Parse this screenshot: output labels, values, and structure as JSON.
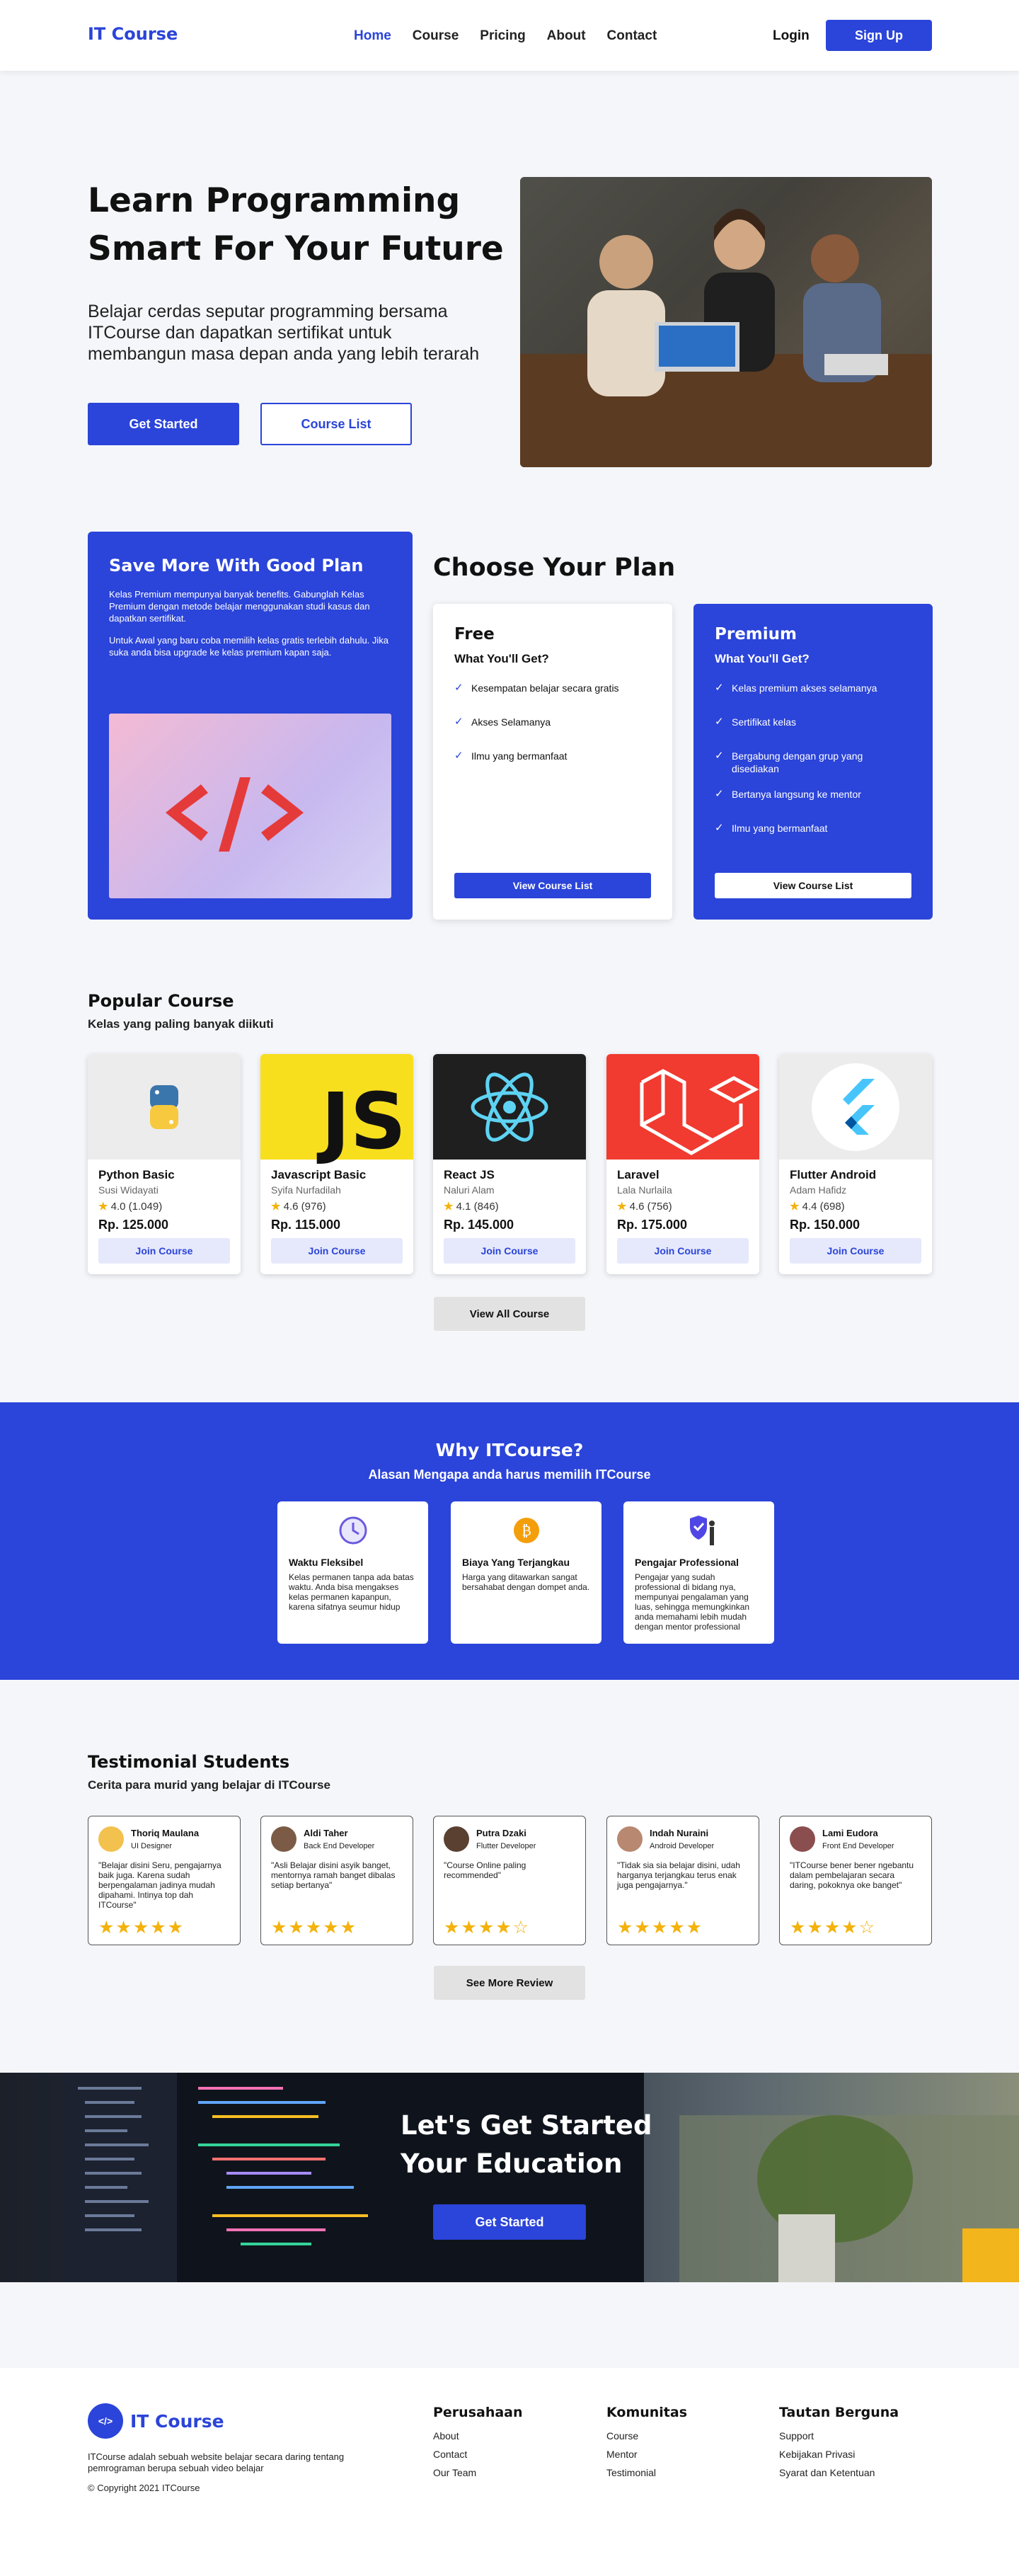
{
  "nav": {
    "logo": "IT Course",
    "menu": [
      "Home",
      "Course",
      "Pricing",
      "About",
      "Contact"
    ],
    "login": "Login",
    "signup": "Sign Up"
  },
  "hero": {
    "title": "Learn Programming Smart For Your Future",
    "subtitle": "Belajar cerdas seputar programming bersama ITCourse dan dapatkan sertifikat untuk membangun masa depan anda yang lebih terarah",
    "primary_button": "Get Started",
    "secondary_button": "Course List"
  },
  "save": {
    "title": "Save More With Good Plan",
    "paragraph1": "Kelas Premium mempunyai banyak benefits. Gabunglah Kelas Premium dengan metode belajar menggunakan studi kasus dan dapatkan sertifikat.",
    "paragraph2": "Untuk Awal yang baru coba memilih kelas gratis terlebih dahulu. Jika suka anda bisa upgrade ke kelas premium kapan saja."
  },
  "plans": {
    "heading": "Choose Your Plan",
    "free": {
      "name": "Free",
      "subtitle": "What You'll Get?",
      "features": [
        "Kesempatan belajar secara gratis",
        "Akses Selamanya",
        "Ilmu yang bermanfaat"
      ],
      "button": "View Course List"
    },
    "premium": {
      "name": "Premium",
      "subtitle": "What You'll Get?",
      "features": [
        "Kelas premium akses selamanya",
        "Sertifikat kelas",
        "Bergabung dengan grup yang disediakan",
        "Bertanya langsung ke mentor",
        "Ilmu yang bermanfaat"
      ],
      "button": "View Course List"
    }
  },
  "popular": {
    "title": "Popular Course",
    "subtitle": "Kelas yang paling banyak diikuti",
    "courses": [
      {
        "title": "Python Basic",
        "author": "Susi Widayati",
        "rating": "4.0",
        "reviews": "(1.049)",
        "price": "Rp. 125.000",
        "button": "Join Course"
      },
      {
        "title": "Javascript Basic",
        "author": "Syifa Nurfadilah",
        "rating": "4.6",
        "reviews": "(976)",
        "price": "Rp. 115.000",
        "button": "Join Course"
      },
      {
        "title": "React JS",
        "author": "Naluri Alam",
        "rating": "4.1",
        "reviews": "(846)",
        "price": "Rp. 145.000",
        "button": "Join Course"
      },
      {
        "title": "Laravel",
        "author": "Lala Nurlaila",
        "rating": "4.6",
        "reviews": "(756)",
        "price": "Rp. 175.000",
        "button": "Join Course"
      },
      {
        "title": "Flutter Android",
        "author": "Adam Hafidz",
        "rating": "4.4",
        "reviews": "(698)",
        "price": "Rp. 150.000",
        "button": "Join Course"
      }
    ],
    "view_all": "View All Course",
    "js_logo_text": "JS"
  },
  "why": {
    "title": "Why ITCourse?",
    "subtitle": "Alasan Mengapa anda harus memilih ITCourse",
    "cards": [
      {
        "title": "Waktu Fleksibel",
        "desc": "Kelas permanen tanpa ada batas waktu. Anda bisa mengakses kelas permanen kapanpun, karena sifatnya seumur hidup"
      },
      {
        "title": "Biaya Yang Terjangkau",
        "desc": "Harga yang ditawarkan sangat bersahabat dengan dompet anda."
      },
      {
        "title": "Pengajar Professional",
        "desc": "Pengajar yang sudah professional di bidang nya, mempunyai pengalaman yang luas, sehingga memungkinkan anda memahami lebih mudah dengan mentor professional"
      }
    ]
  },
  "testimonial": {
    "title": "Testimonial Students",
    "subtitle": "Cerita para murid yang belajar di ITCourse",
    "items": [
      {
        "name": "Thoriq Maulana",
        "role": "UI Designer",
        "quote": "\"Belajar disini Seru, pengajarnya baik juga. Karena sudah berpengalaman jadinya mudah dipahami. Intinya top dah ITCourse\"",
        "stars": "★★★★★"
      },
      {
        "name": "Aldi Taher",
        "role": "Back End Developer",
        "quote": "\"Asli Belajar disini asyik banget, mentornya ramah banget dibalas setiap bertanya\"",
        "stars": "★★★★★"
      },
      {
        "name": "Putra Dzaki",
        "role": "Flutter Developer",
        "quote": "\"Course Online paling recommended\"",
        "stars": "★★★★☆"
      },
      {
        "name": "Indah Nuraini",
        "role": "Android Developer",
        "quote": "\"Tidak sia sia belajar disini, udah harganya terjangkau terus enak juga pengajarnya.\"",
        "stars": "★★★★★"
      },
      {
        "name": "Lami Eudora",
        "role": "Front End Developer",
        "quote": "\"ITCourse bener bener ngebantu dalam pembelajaran secara daring, pokoknya oke banget\"",
        "stars": "★★★★☆"
      }
    ],
    "see_more": "See More Review"
  },
  "cta": {
    "title": "Let's Get Started Your Education",
    "button": "Get Started"
  },
  "footer": {
    "logo_mark": "</>",
    "logo": "IT Course",
    "desc": "ITCourse adalah sebuah website belajar secara daring tentang pemrograman berupa sebuah video belajar",
    "copyright": "© Copyright 2021 ITCourse",
    "columns": [
      {
        "title": "Perusahaan",
        "links": [
          "About",
          "Contact",
          "Our Team"
        ]
      },
      {
        "title": "Komunitas",
        "links": [
          "Course",
          "Mentor",
          "Testimonial"
        ]
      },
      {
        "title": "Tautan Berguna",
        "links": [
          "Support",
          "Kebijakan Privasi",
          "Syarat dan Ketentuan"
        ]
      }
    ]
  },
  "colors": {
    "primary": "#2b44d9",
    "star": "#f3b20c"
  }
}
